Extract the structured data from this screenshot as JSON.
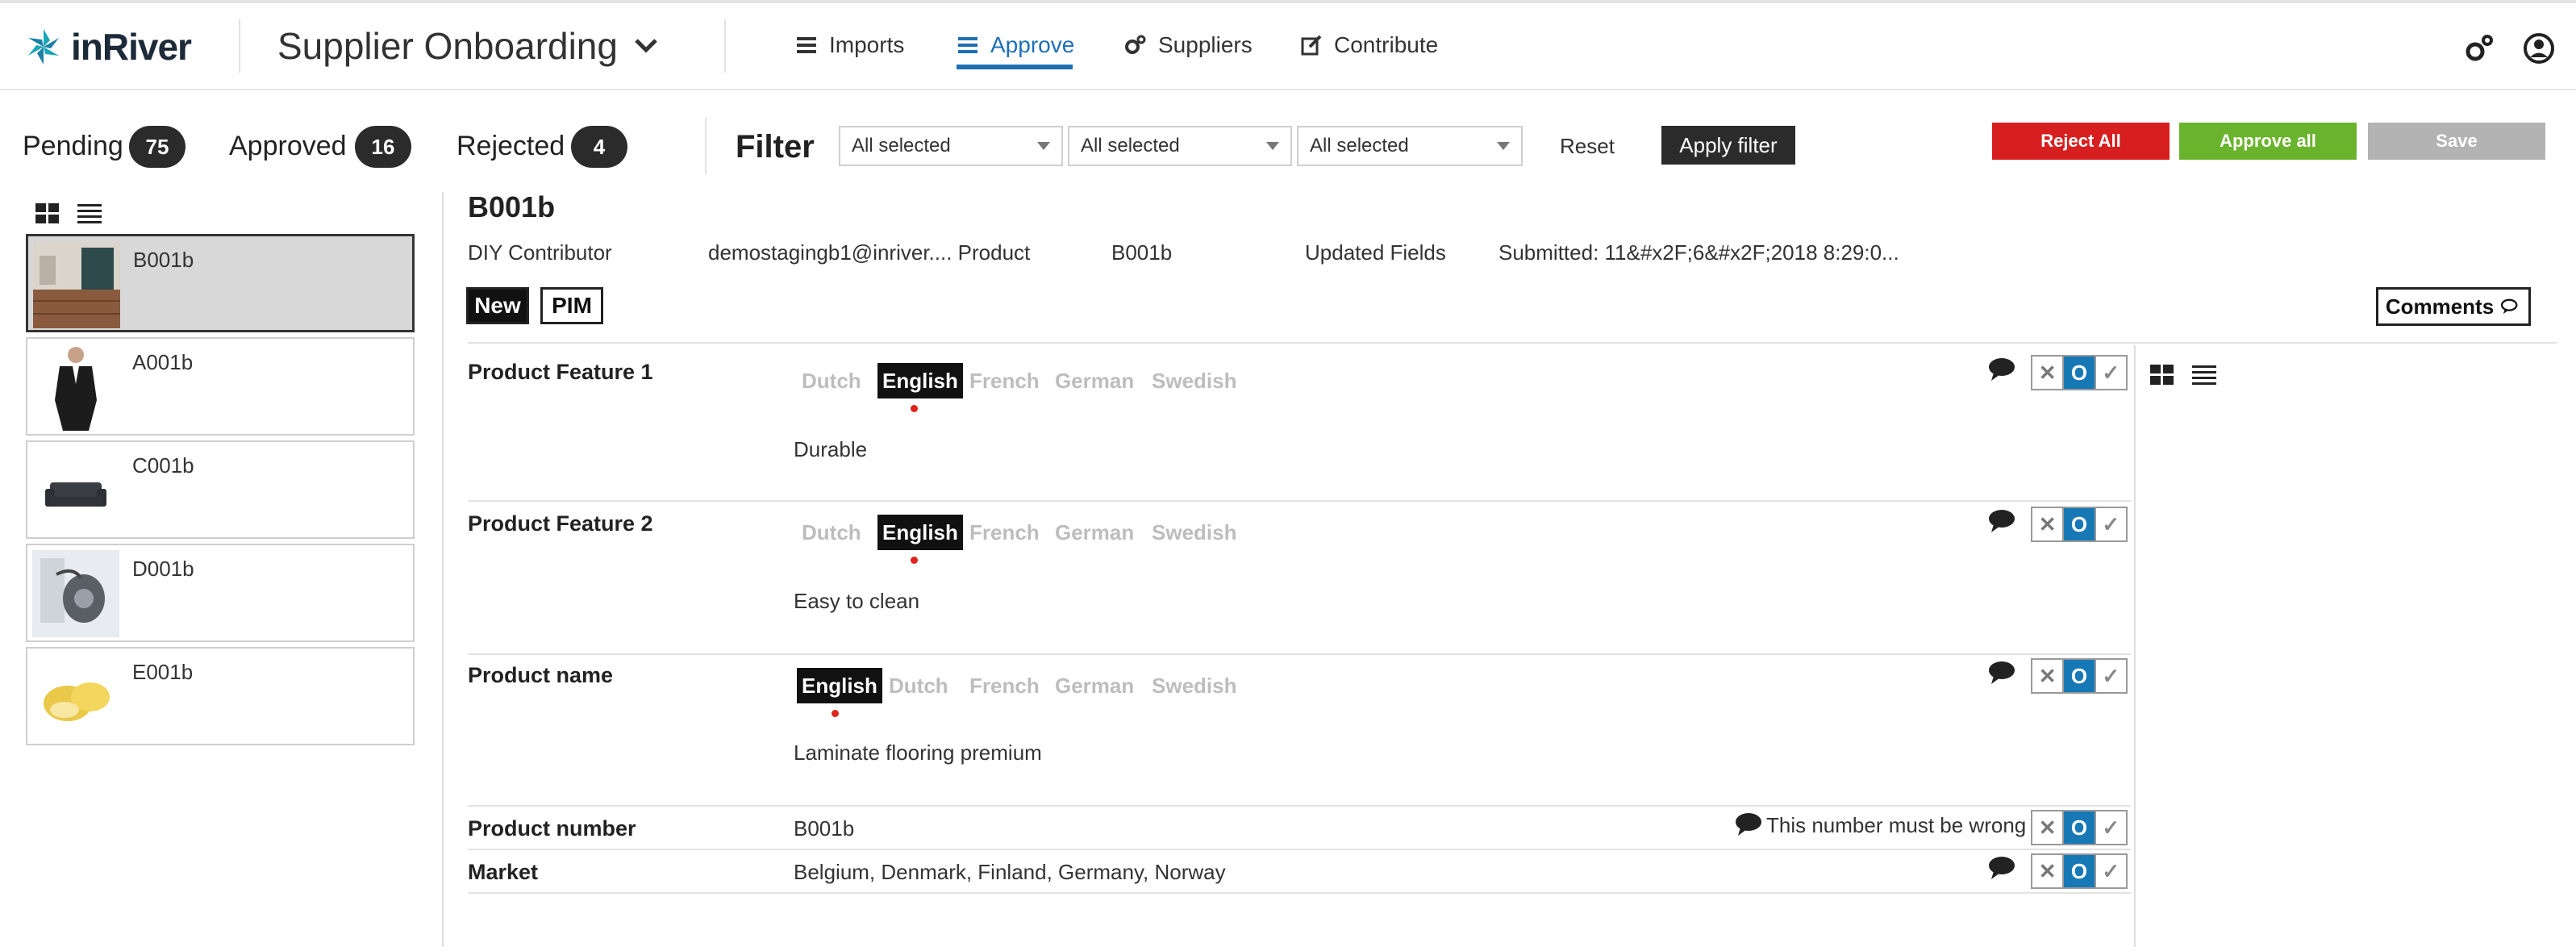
{
  "header": {
    "logo_text": "inRiver",
    "app_title": "Supplier Onboarding",
    "nav": [
      {
        "label": "Imports",
        "icon": "list-icon",
        "active": false
      },
      {
        "label": "Approve",
        "icon": "approve-icon",
        "active": true
      },
      {
        "label": "Suppliers",
        "icon": "cogs-icon",
        "active": false
      },
      {
        "label": "Contribute",
        "icon": "edit-icon",
        "active": false
      }
    ],
    "accent_color": "#1f6fb5"
  },
  "status": {
    "pending": {
      "label": "Pending",
      "count": "75"
    },
    "approved": {
      "label": "Approved",
      "count": "16"
    },
    "rejected": {
      "label": "Rejected",
      "count": "4"
    }
  },
  "filter": {
    "label": "Filter",
    "selects": [
      "All selected",
      "All selected",
      "All selected"
    ],
    "reset_label": "Reset",
    "apply_label": "Apply filter"
  },
  "actions": {
    "reject_all": "Reject All",
    "approve_all": "Approve all",
    "save": "Save",
    "reject_color": "#d71f1f",
    "approve_color": "#6ab42d",
    "save_color": "#b3b3b3"
  },
  "products": [
    {
      "id": "B001b",
      "selected": true,
      "thumb": "flooring"
    },
    {
      "id": "A001b",
      "selected": false,
      "thumb": "suit"
    },
    {
      "id": "C001b",
      "selected": false,
      "thumb": "sofa"
    },
    {
      "id": "D001b",
      "selected": false,
      "thumb": "vacuum"
    },
    {
      "id": "E001b",
      "selected": false,
      "thumb": "potatoes"
    }
  ],
  "detail": {
    "title": "B001b",
    "contributor": "DIY Contributor",
    "email": "demostagingb1@inriver.... Product",
    "product_id": "B001b",
    "updated": "Updated Fields",
    "submitted": "Submitted: 11&#x2F;6&#x2F;2018 8:29:0...",
    "tag_new": "New",
    "tag_pim": "PIM",
    "comments_label": "Comments"
  },
  "fields": [
    {
      "label": "Product Feature 1",
      "languages": [
        "Dutch",
        "English",
        "French",
        "German",
        "Swedish"
      ],
      "active_language": "English",
      "value": "Durable"
    },
    {
      "label": "Product Feature 2",
      "languages": [
        "Dutch",
        "English",
        "French",
        "German",
        "Swedish"
      ],
      "active_language": "English",
      "value": "Easy to clean"
    },
    {
      "label": "Product name",
      "languages": [
        "English",
        "Dutch",
        "French",
        "German",
        "Swedish"
      ],
      "active_language": "English",
      "value": "Laminate flooring premium"
    },
    {
      "label": "Product number",
      "value": "B001b",
      "comment": "This number must be wrong"
    },
    {
      "label": "Market",
      "value": "Belgium, Denmark, Finland, Germany, Norway"
    }
  ],
  "toggle": {
    "reject": "✕",
    "neutral": "O",
    "approve": "✓"
  }
}
